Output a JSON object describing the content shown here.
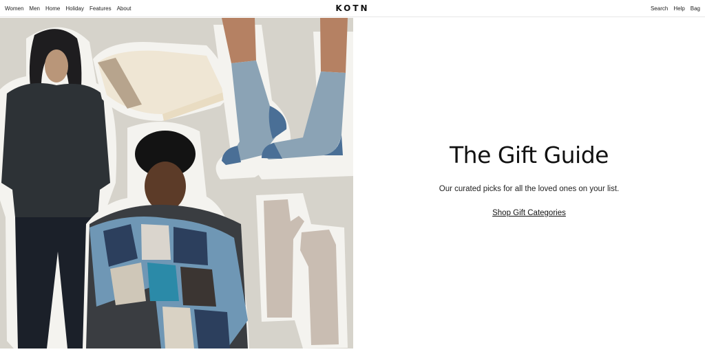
{
  "header": {
    "logo": "KOTN",
    "nav_left": [
      "Women",
      "Men",
      "Home",
      "Holiday",
      "Features",
      "About"
    ],
    "nav_right": [
      "Search",
      "Help",
      "Bag"
    ]
  },
  "hero": {
    "title": "The Gift Guide",
    "subtitle": "Our curated picks for all the loved ones on your list.",
    "cta": "Shop Gift Categories"
  },
  "collage": {
    "background_color": "#d6d3cb",
    "items": [
      "man-sweater",
      "throw-blanket",
      "socks",
      "woman-plaid-scarf",
      "knit-gloves"
    ]
  }
}
